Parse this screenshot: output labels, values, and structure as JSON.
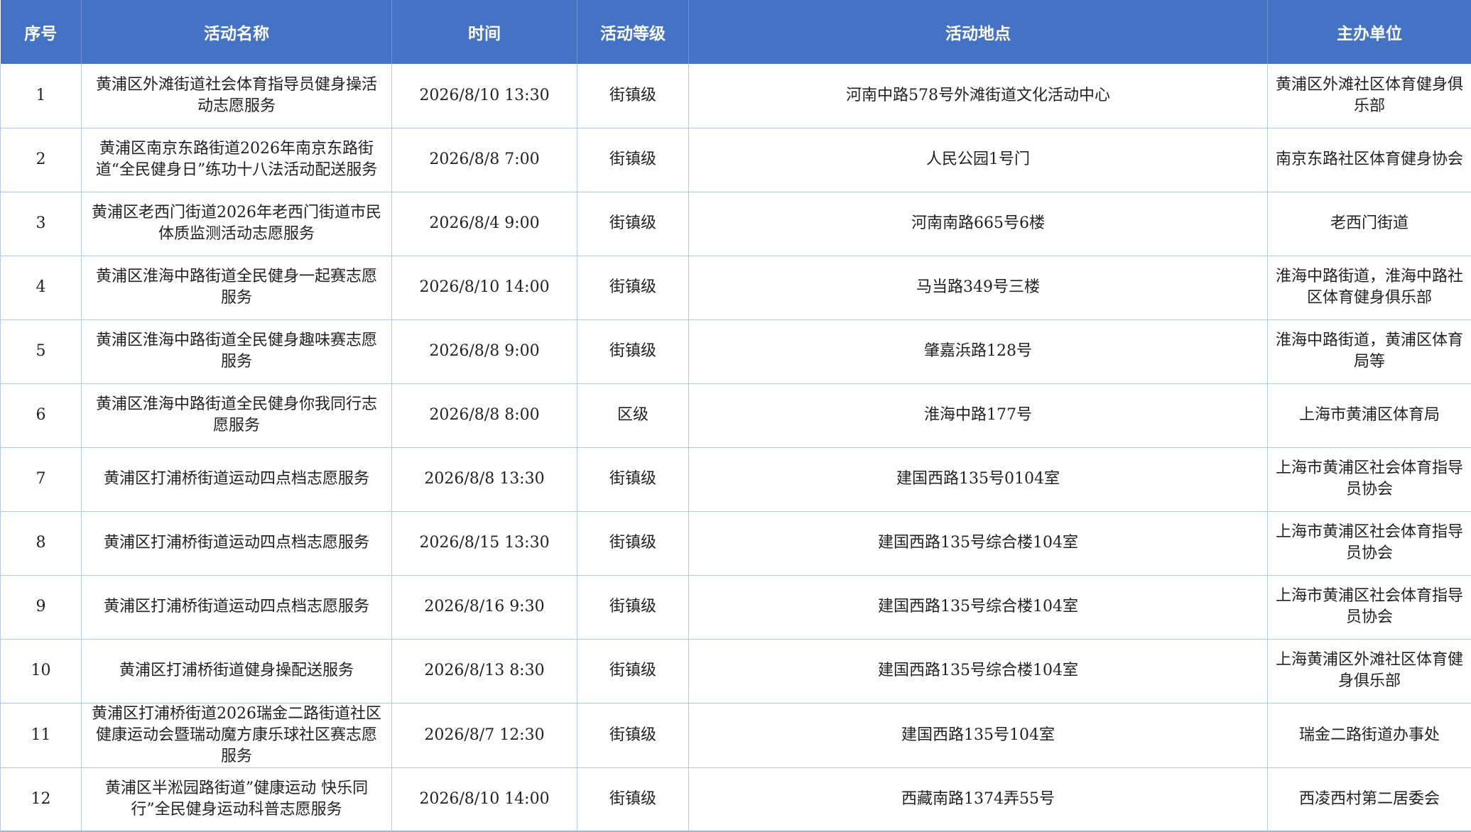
{
  "table": {
    "headers": [
      "序号",
      "活动名称",
      "时间",
      "活动等级",
      "活动地点",
      "主办单位"
    ],
    "rows": [
      [
        "1",
        "黄浦区外滩街道社会体育指导员健身操活动志愿服务",
        "2026/8/10 13:30",
        "街镇级",
        "河南中路578号外滩街道文化活动中心",
        "黄浦区外滩社区体育健身俱乐部"
      ],
      [
        "2",
        "黄浦区南京东路街道2026年南京东路街道“全民健身日”练功十八法活动配送服务",
        "2026/8/8 7:00",
        "街镇级",
        "人民公园1号门",
        "南京东路社区体育健身协会"
      ],
      [
        "3",
        "黄浦区老西门街道2026年老西门街道市民体质监测活动志愿服务",
        "2026/8/4 9:00",
        "街镇级",
        "河南南路665号6楼",
        "老西门街道"
      ],
      [
        "4",
        "黄浦区淮海中路街道全民健身一起赛志愿服务",
        "2026/8/10 14:00",
        "街镇级",
        "马当路349号三楼",
        "淮海中路街道，淮海中路社区体育健身俱乐部"
      ],
      [
        "5",
        "黄浦区淮海中路街道全民健身趣味赛志愿服务",
        "2026/8/8 9:00",
        "街镇级",
        "肇嘉浜路128号",
        "淮海中路街道，黄浦区体育局等"
      ],
      [
        "6",
        "黄浦区淮海中路街道全民健身你我同行志愿服务",
        "2026/8/8 8:00",
        "区级",
        "淮海中路177号",
        "上海市黄浦区体育局"
      ],
      [
        "7",
        "黄浦区打浦桥街道运动四点档志愿服务",
        "2026/8/8 13:30",
        "街镇级",
        "建国西路135号0104室",
        "上海市黄浦区社会体育指导员协会"
      ],
      [
        "8",
        "黄浦区打浦桥街道运动四点档志愿服务",
        "2026/8/15 13:30",
        "街镇级",
        "建国西路135号综合楼104室",
        "上海市黄浦区社会体育指导员协会"
      ],
      [
        "9",
        "黄浦区打浦桥街道运动四点档志愿服务",
        "2026/8/16 9:30",
        "街镇级",
        "建国西路135号综合楼104室",
        "上海市黄浦区社会体育指导员协会"
      ],
      [
        "10",
        "黄浦区打浦桥街道健身操配送服务",
        "2026/8/13 8:30",
        "街镇级",
        "建国西路135号综合楼104室",
        "上海黄浦区外滩社区体育健身俱乐部"
      ],
      [
        "11",
        "黄浦区打浦桥街道2026瑞金二路街道社区健康运动会暨瑞动魔方康乐球社区赛志愿服务",
        "2026/8/7 12:30",
        "街镇级",
        "建国西路135号104室",
        "瑞金二路街道办事处"
      ],
      [
        "12",
        "黄浦区半淞园路街道”健康运动 快乐同行”全民健身运动科普志愿服务",
        "2026/8/10 14:00",
        "街镇级",
        "西藏南路1374弄55号",
        "西凌西村第二居委会"
      ]
    ]
  },
  "colors": {
    "header_bg": "#4472c4",
    "header_text": "#ffffff",
    "grid_line": "#b4c7e7"
  }
}
